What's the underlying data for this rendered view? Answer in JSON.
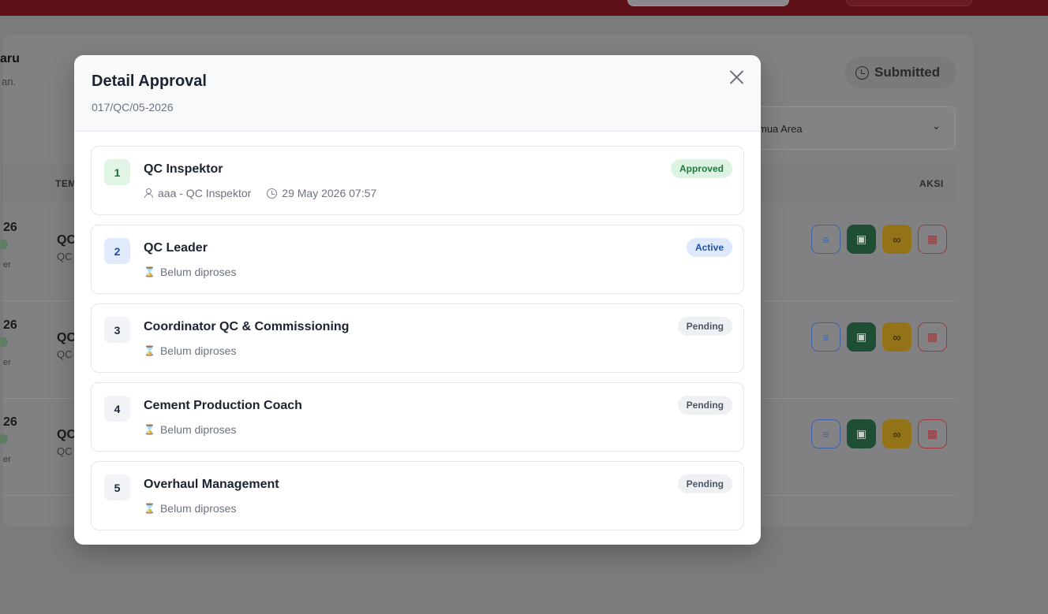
{
  "background": {
    "card_title": "aru",
    "card_sub": "an.",
    "status_pill": "Submitted",
    "area_select": "mua Area",
    "table_headers": {
      "tem": "TEM",
      "aksi": "AKSI"
    },
    "rows": [
      {
        "year": "26",
        "q1": "QC",
        "q2": "QC",
        "er": "er"
      },
      {
        "year": "26",
        "q1": "QC",
        "q2": "QC",
        "er": "er"
      },
      {
        "year": "26",
        "q1": "QC",
        "q2": "QC",
        "er": "er"
      }
    ]
  },
  "modal": {
    "title": "Detail Approval",
    "subtitle": "017/QC/05-2026",
    "steps": [
      {
        "num": "1",
        "title": "QC Inspektor",
        "status": "Approved",
        "user": "aaa - QC Inspektor",
        "time": "29 May 2026 07:57"
      },
      {
        "num": "2",
        "title": "QC Leader",
        "status": "Active",
        "note": "Belum diproses"
      },
      {
        "num": "3",
        "title": "Coordinator QC & Commissioning",
        "status": "Pending",
        "note": "Belum diproses"
      },
      {
        "num": "4",
        "title": "Cement Production Coach",
        "status": "Pending",
        "note": "Belum diproses"
      },
      {
        "num": "5",
        "title": "Overhaul Management",
        "status": "Pending",
        "note": "Belum diproses"
      }
    ]
  },
  "colors": {
    "approved": "#1f7a3c",
    "active": "#2052a8",
    "pending": "#4b5563",
    "topbar": "#5e0f17"
  },
  "icons": {
    "close": "close-icon",
    "user": "user-icon",
    "clock": "clock-icon",
    "hourglass": "hourglass-icon",
    "chevron": "chevron-down-icon"
  }
}
